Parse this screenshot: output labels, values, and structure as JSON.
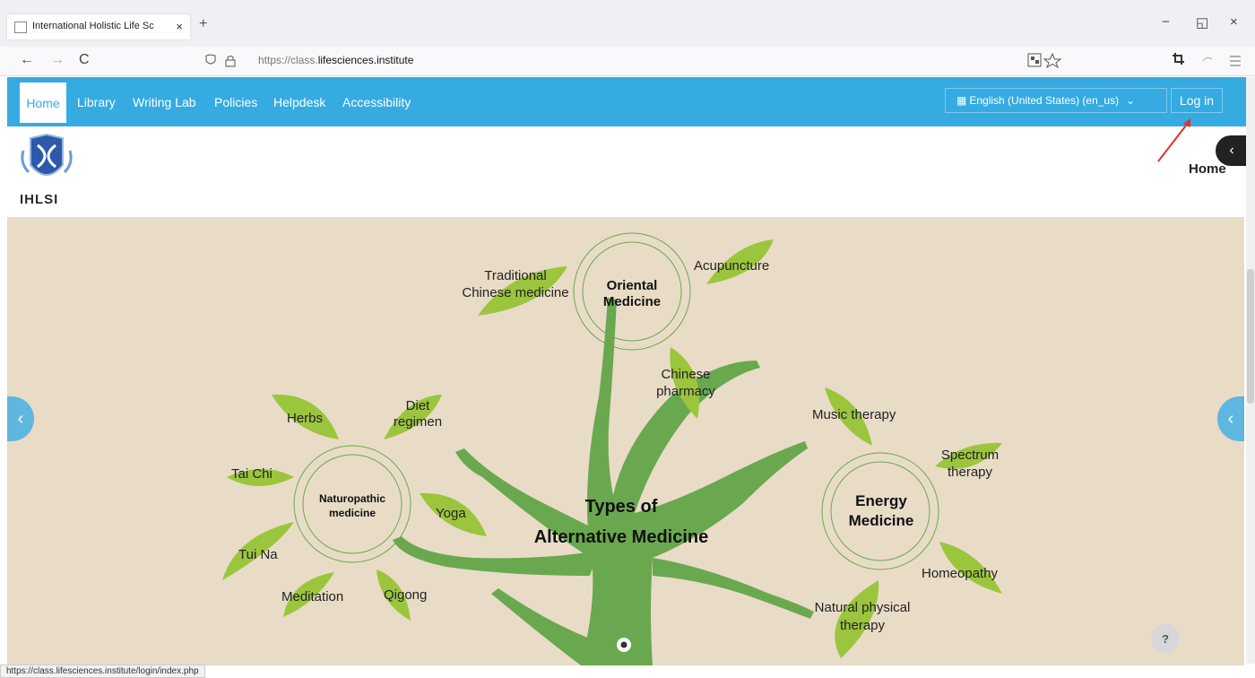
{
  "browser": {
    "tab_title": "International Holistic Life Sc",
    "url_prefix": "https://class.",
    "url_domain": "lifesciences.institute",
    "status_url": "https://class.lifesciences.institute/login/index.php",
    "new_tab": "+",
    "back_icon": "←",
    "forward_icon": "→",
    "reload_icon": "C",
    "close_tab": "×",
    "minimize": "−",
    "restore": "◱",
    "close": "×"
  },
  "site_nav": {
    "items": [
      "Home",
      "Library",
      "Writing Lab",
      "Policies",
      "Helpdesk",
      "Accessibility"
    ],
    "language": "English (United States) (en_us)",
    "language_caret": "⌄",
    "login": "Log in"
  },
  "header": {
    "logo_text": "IHLSI",
    "breadcrumb": "Home",
    "drawer_icon": "‹"
  },
  "slide": {
    "title_line1": "Types of",
    "title_line2": "Alternative Medicine",
    "oriental": {
      "name_line1": "Oriental",
      "name_line2": "Medicine",
      "leaves": [
        "Traditional",
        "Chinese medicine",
        "Acupuncture",
        "Chinese",
        "pharmacy"
      ]
    },
    "naturopathic": {
      "name_line1": "Naturopathic",
      "name_line2": "medicine",
      "leaves": [
        "Herbs",
        "Diet",
        "regimen",
        "Tai Chi",
        "Yoga",
        "Tui Na",
        "Meditation",
        "Qigong"
      ]
    },
    "energy": {
      "name_line1": "Energy",
      "name_line2": "Medicine",
      "leaves": [
        "Music therapy",
        "Spectrum",
        "therapy",
        "Homeopathy",
        "Natural physical",
        "therapy"
      ]
    },
    "prev_icon": "‹",
    "next_icon": "‹",
    "help": "?"
  },
  "colors": {
    "nav_blue": "#35abe2",
    "leaf_green": "#9bc53d",
    "tree_green": "#6aa84f",
    "slide_bg": "#e8dcc7"
  }
}
